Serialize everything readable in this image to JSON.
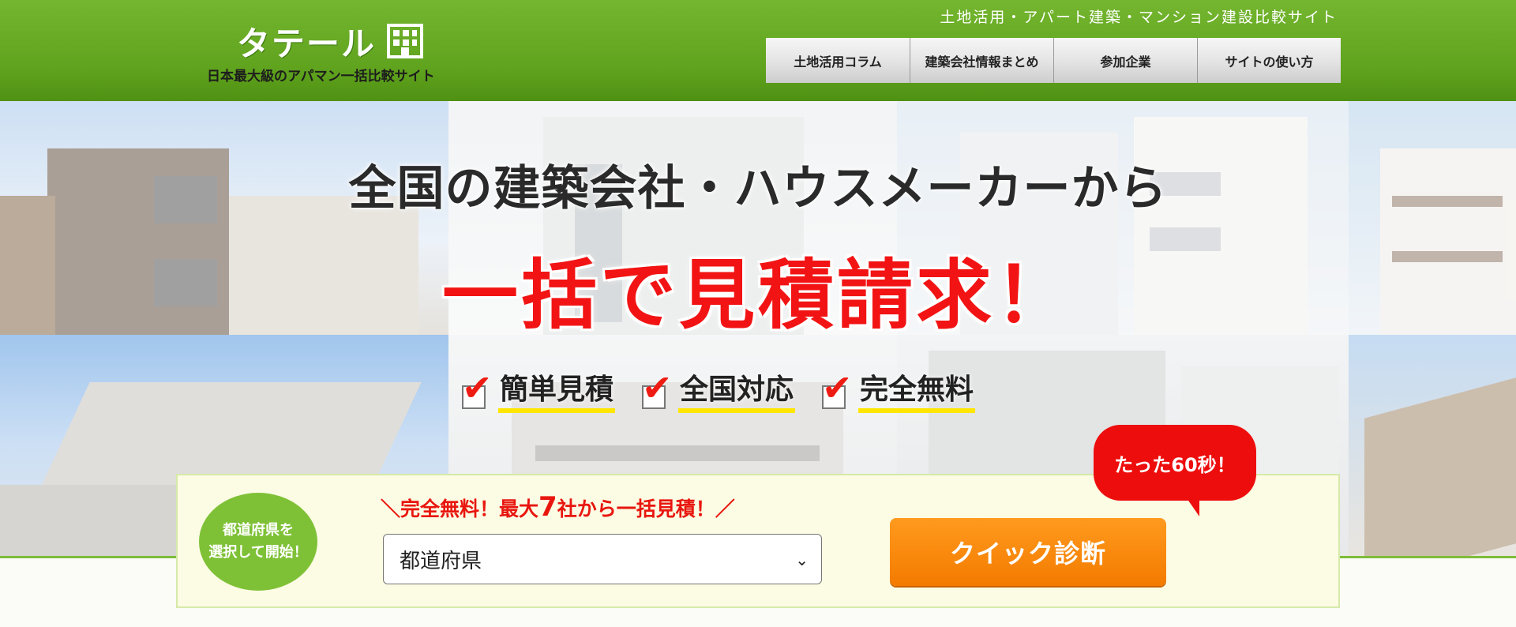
{
  "header": {
    "logo_title": "タテール",
    "logo_subtitle": "日本最大級のアパマン一括比較サイト",
    "tagline": "土地活用・アパート建築・マンション建設比較サイト",
    "nav": [
      {
        "label": "土地活用コラム"
      },
      {
        "label": "建築会社情報まとめ"
      },
      {
        "label": "参加企業"
      },
      {
        "label": "サイトの使い方"
      }
    ]
  },
  "hero": {
    "headline": "全国の建築会社・ハウスメーカーから",
    "headline_emphasis": "一括で見積請求！",
    "features": [
      {
        "label": "簡単見積",
        "icon": "check-icon"
      },
      {
        "label": "全国対応",
        "icon": "check-icon"
      },
      {
        "label": "完全無料",
        "icon": "check-icon"
      }
    ]
  },
  "search_panel": {
    "start_bubble": "都道府県を\n選択して開始！",
    "promo_prefix": "＼完全無料！最大",
    "promo_number": "7",
    "promo_suffix": "社から一括見積！／",
    "prefecture_select": {
      "selected": "都道府県"
    },
    "cta_label": "クイック診断",
    "time_bubble": "たった60秒！"
  },
  "colors": {
    "header_green": "#5fa21d",
    "emphasis_red": "#f21414",
    "cta_orange": "#f37b00",
    "bubble_green": "#7ec136",
    "highlight_yellow": "#ffe600"
  }
}
